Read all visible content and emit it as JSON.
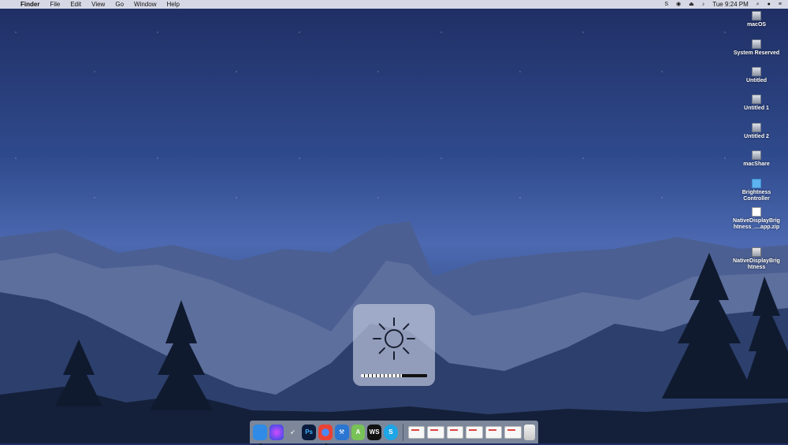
{
  "menubar": {
    "apple_icon": "",
    "app_name": "Finder",
    "menus": [
      "File",
      "Edit",
      "View",
      "Go",
      "Window",
      "Help"
    ],
    "status_icons": [
      "skype-icon",
      "eye-icon",
      "eject-icon",
      "volume-icon"
    ],
    "time": "Tue 9:24 PM",
    "right_icons": [
      "search-icon",
      "user-icon",
      "list-icon"
    ]
  },
  "desktop": {
    "items": [
      {
        "label": "macOS",
        "type": "drive"
      },
      {
        "label": "System Reserved",
        "type": "drive"
      },
      {
        "label": "Untitled",
        "type": "drive"
      },
      {
        "label": "Untitled 1",
        "type": "drive"
      },
      {
        "label": "Untitled 2",
        "type": "drive"
      },
      {
        "label": "macShare",
        "type": "drive"
      },
      {
        "label": "Brightness Controller",
        "type": "folder"
      },
      {
        "label": "NativeDisplayBrightness_....app.zip",
        "type": "zip"
      },
      {
        "label": "NativeDisplayBrightness",
        "type": "app"
      }
    ]
  },
  "brightness_hud": {
    "icon": "brightness-sun-icon",
    "level": 0.62
  },
  "dock": {
    "apps": [
      {
        "name": "finder",
        "color": "#2f8be6"
      },
      {
        "name": "siri",
        "color": "#5b3fb6"
      },
      {
        "name": "launchpad",
        "color": "#7d8799"
      },
      {
        "name": "photoshop",
        "color": "#0b1b3b"
      },
      {
        "name": "chrome",
        "color": "#e94235"
      },
      {
        "name": "xcode",
        "color": "#2a76d2"
      },
      {
        "name": "android-studio",
        "color": "#78c257"
      },
      {
        "name": "webstorm",
        "color": "#111111"
      },
      {
        "name": "skype",
        "color": "#1ea5e6"
      }
    ],
    "windows": 6,
    "trash": "trash-icon",
    "labels": {
      "photoshop": "Ps",
      "webstorm": "WS",
      "skype": "S"
    }
  }
}
